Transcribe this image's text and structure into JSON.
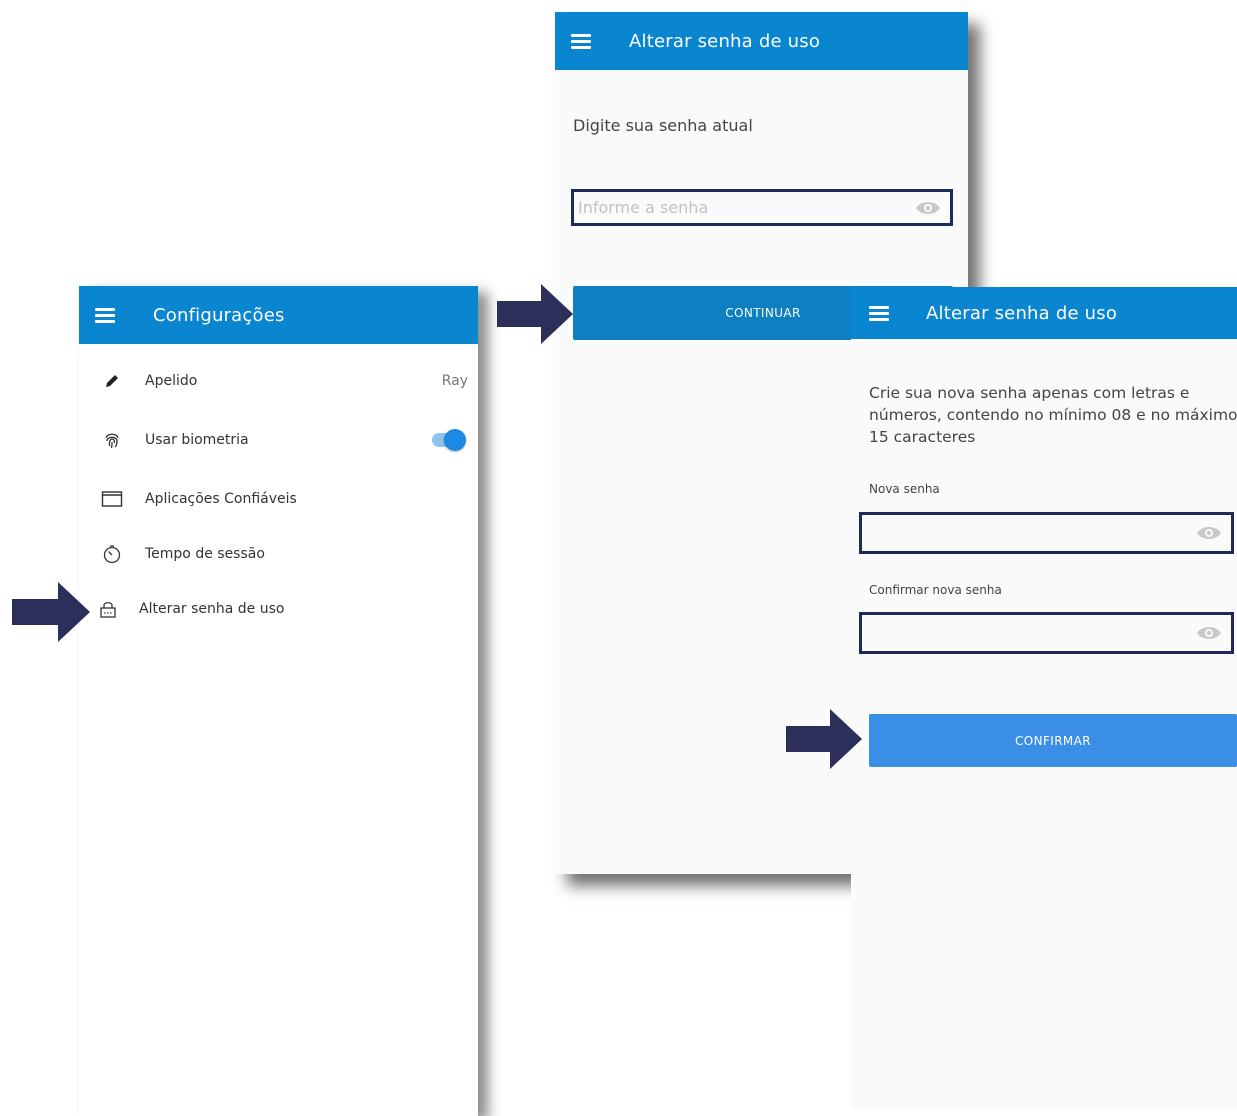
{
  "settings": {
    "title": "Configurações",
    "items": [
      {
        "icon": "pencil-icon",
        "label": "Apelido",
        "value": "Ray"
      },
      {
        "icon": "fingerprint-icon",
        "label": "Usar biometria",
        "toggle": true
      },
      {
        "icon": "window-icon",
        "label": "Aplicações Confiáveis"
      },
      {
        "icon": "timer-icon",
        "label": "Tempo de sessão"
      },
      {
        "icon": "lock-icon",
        "label": "Alterar senha de uso"
      }
    ]
  },
  "current_password": {
    "title": "Alterar senha de uso",
    "instruction": "Digite sua senha atual",
    "input_placeholder": "Informe a senha",
    "continue_label": "CONTINUAR"
  },
  "new_password": {
    "title": "Alterar senha de uso",
    "instruction": "Crie sua nova senha apenas com letras e números, contendo no mínimo 08 e no máximo 15 caracteres",
    "new_label": "Nova senha",
    "confirm_label": "Confirmar nova senha",
    "confirm_button": "CONFIRMAR"
  },
  "colors": {
    "appbar": "#0a85d0",
    "continue_button": "#0e7fc0",
    "confirm_button": "#3a8ee6",
    "field_border": "#1f2a5c",
    "arrow": "#2b2f5a"
  }
}
